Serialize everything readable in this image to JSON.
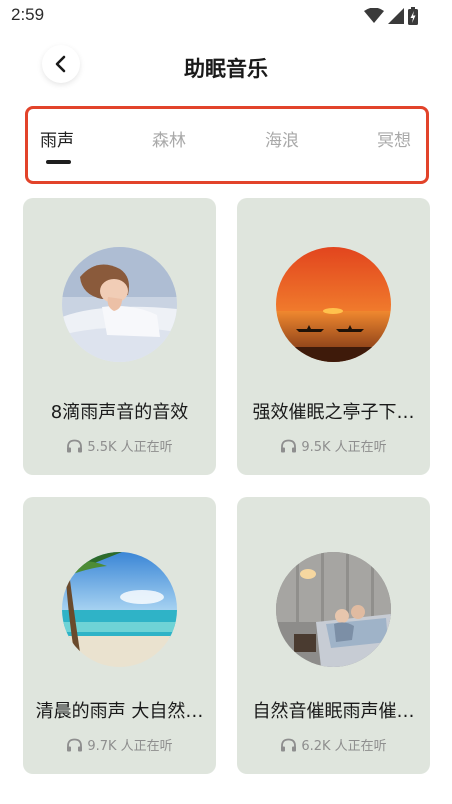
{
  "status_bar": {
    "time": "2:59"
  },
  "header": {
    "title": "助眠音乐"
  },
  "tabs": [
    {
      "label": "雨声",
      "active": true
    },
    {
      "label": "森林",
      "active": false
    },
    {
      "label": "海浪",
      "active": false
    },
    {
      "label": "冥想",
      "active": false
    }
  ],
  "cards": [
    {
      "title": "8滴雨声音的音效",
      "listeners": "5.5K 人正在听",
      "cover": "sleeping-woman"
    },
    {
      "title": "强效催眠之亭子下…",
      "listeners": "9.5K 人正在听",
      "cover": "sunset-lake"
    },
    {
      "title": "清晨的雨声 大自然…",
      "listeners": "9.7K 人正在听",
      "cover": "tropical-beach"
    },
    {
      "title": "自然音催眠雨声催…",
      "listeners": "6.2K 人正在听",
      "cover": "bedroom-couple"
    }
  ],
  "colors": {
    "accent_frame": "#e2432a",
    "card_bg": "#dfe5dd",
    "muted_text": "#8e8e8e"
  }
}
